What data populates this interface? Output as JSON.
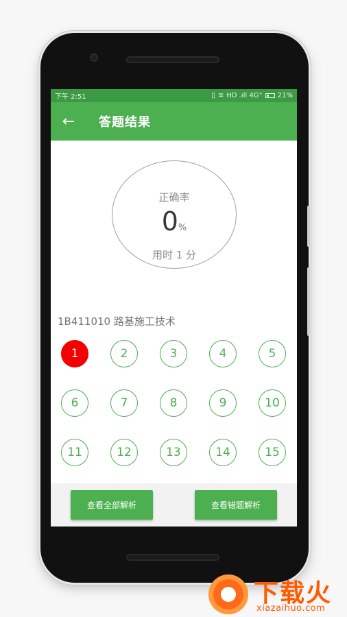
{
  "status_bar": {
    "time": "下午 2:51",
    "network": "HD .ıll 4G⁺",
    "battery": "21%"
  },
  "toolbar": {
    "back_icon": "arrow-left-icon",
    "title": "答题结果"
  },
  "result": {
    "rate_label": "正确率",
    "rate_value": "0",
    "rate_unit": "%",
    "time_used": "用时 1 分"
  },
  "section": {
    "title": "1B411010 路基施工技术"
  },
  "questions": [
    {
      "label": "1",
      "status": "wrong"
    },
    {
      "label": "2",
      "status": "normal"
    },
    {
      "label": "3",
      "status": "normal"
    },
    {
      "label": "4",
      "status": "normal"
    },
    {
      "label": "5",
      "status": "normal"
    },
    {
      "label": "6",
      "status": "normal"
    },
    {
      "label": "7",
      "status": "normal"
    },
    {
      "label": "8",
      "status": "normal"
    },
    {
      "label": "9",
      "status": "normal"
    },
    {
      "label": "10",
      "status": "normal"
    },
    {
      "label": "11",
      "status": "normal"
    },
    {
      "label": "12",
      "status": "normal"
    },
    {
      "label": "13",
      "status": "normal"
    },
    {
      "label": "14",
      "status": "normal"
    },
    {
      "label": "15",
      "status": "normal"
    }
  ],
  "actions": {
    "view_all": "查看全部解析",
    "view_wrong": "查看错题解析"
  },
  "watermark": {
    "brand": "下载火",
    "domain": "xiazaihuo.com"
  },
  "colors": {
    "primary": "#4caf50",
    "status_bar": "#3d9a44",
    "wrong": "#f40000"
  }
}
